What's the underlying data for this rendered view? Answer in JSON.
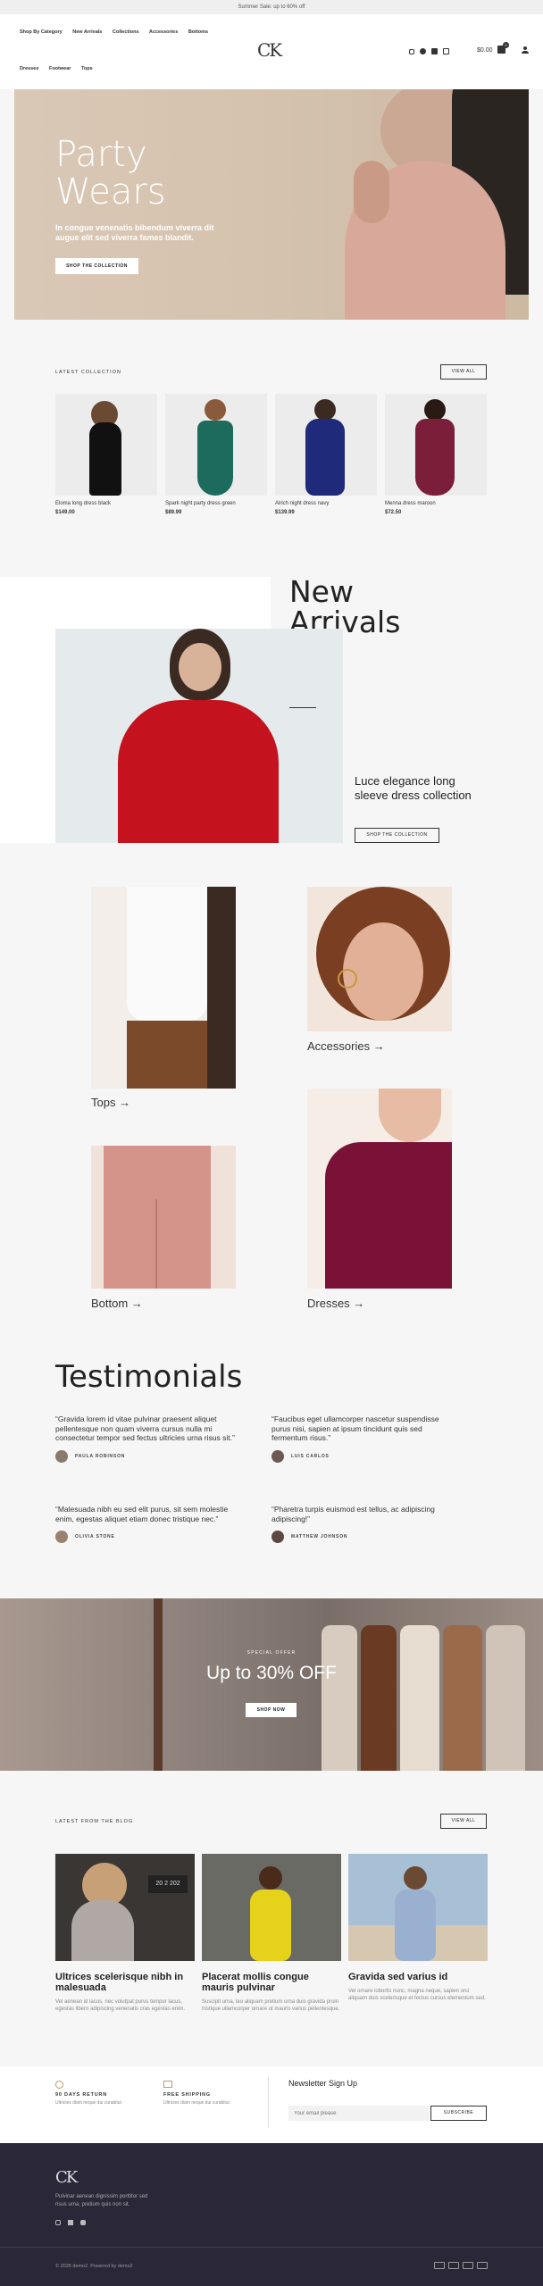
{
  "topbar": {
    "text": "Summer Sale: up to 60% off"
  },
  "header": {
    "nav_row1": [
      "Shop By Category",
      "New Arrivals",
      "Collections",
      "Accessories",
      "Bottoms"
    ],
    "nav_row2": [
      "Dresses",
      "Footwear",
      "Tops"
    ],
    "logo": "CK",
    "cart_total": "$0.00",
    "cart_count": "0"
  },
  "hero": {
    "title_line1": "Party",
    "title_line2": "Wears",
    "subtitle": "In congue venenatis bibendum viverra dit augue elit sed viverra fames blandit.",
    "button": "SHOP THE COLLECTION"
  },
  "latest": {
    "label": "LATEST COLLECTION",
    "view_all": "VIEW ALL",
    "products": [
      {
        "name": "Eloma long dress black",
        "price": "$149.00",
        "color": "#111111"
      },
      {
        "name": "Spark night party dress green",
        "price": "$89.99",
        "color": "#1d6b5c"
      },
      {
        "name": "Alrich night dress navy",
        "price": "$139.99",
        "color": "#1f2a7a"
      },
      {
        "name": "Menna dress maroon",
        "price": "$72.50",
        "color": "#7a1e3a"
      }
    ]
  },
  "arrivals": {
    "title_line1": "New",
    "title_line2": "Arrivals",
    "heading": "Luce elegance long sleeve dress collection",
    "button": "SHOP THE COLLECTION"
  },
  "categories": [
    {
      "label": "Tops →"
    },
    {
      "label": "Accessories →"
    },
    {
      "label": "Bottom →"
    },
    {
      "label": "Dresses →"
    }
  ],
  "testimonials": {
    "title": "Testimonials",
    "items": [
      {
        "text": "“Gravida lorem id vitae pulvinar praesent aliquet pellentesque non quam viverra cursus nulla mi consectetur tempor sed fectus ultricies urna risus sit.”",
        "author": "PAULA ROBINSON"
      },
      {
        "text": "“Faucibus eget ullamcorper nascetur suspendisse purus nisi, sapien at ipsum tincidunt quis sed fermentum risus.”",
        "author": "LUIS CARLOS"
      },
      {
        "text": "“Malesuada nibh eu sed elit purus, sit sem molestie enim, egestas aliquet etiam donec tristique nec.”",
        "author": "OLIVIA STONE"
      },
      {
        "text": "“Pharetra turpis euismod est tellus, ac adipiscing adipiscing!”",
        "author": "MATTHEW JOHNSON"
      }
    ]
  },
  "offer": {
    "label": "SPECIAL OFFER",
    "title": "Up to 30% OFF",
    "button": "SHOP NOW"
  },
  "blog": {
    "label": "LATEST FROM THE BLOG",
    "view_all": "VIEW ALL",
    "posts": [
      {
        "title": "Ultrices scelerisque nibh in malesuada",
        "text": "Vel aenean id lacus, nec volutpat purus tempor lacus, egestas libero adipiscing venenatis cras egestas enim.",
        "sign": "20 2 202"
      },
      {
        "title": "Placerat mollis congue mauris pulvinar",
        "text": "Suscipit urna, leo aliquam pretium urna duis gravida proin tristique ullamcorper ornare ut mauris varius pellentesque.",
        "sign": ""
      },
      {
        "title": "Gravida sed varius id",
        "text": "Vel ornare lobortis nunc, magna neque, sapien orci aliquam duis scelerisque et fectus cursus elementum sed.",
        "sign": ""
      }
    ]
  },
  "features": [
    {
      "title": "90 DAYS RETURN",
      "text": "Ultricies diam neque dui curabitur."
    },
    {
      "title": "FREE SHIPPING",
      "text": "Ultricies diam neque dui curabitur."
    }
  ],
  "newsletter": {
    "title": "Newsletter Sign Up",
    "placeholder": "Your email please",
    "button": "SUBSCRIBE"
  },
  "footer": {
    "logo": "CK",
    "text": "Pulvinar aenean dignissim porttitor sed risus urna, pretium quis non sit.",
    "copyright": "© 2026 demo2. Powered by demo2"
  }
}
